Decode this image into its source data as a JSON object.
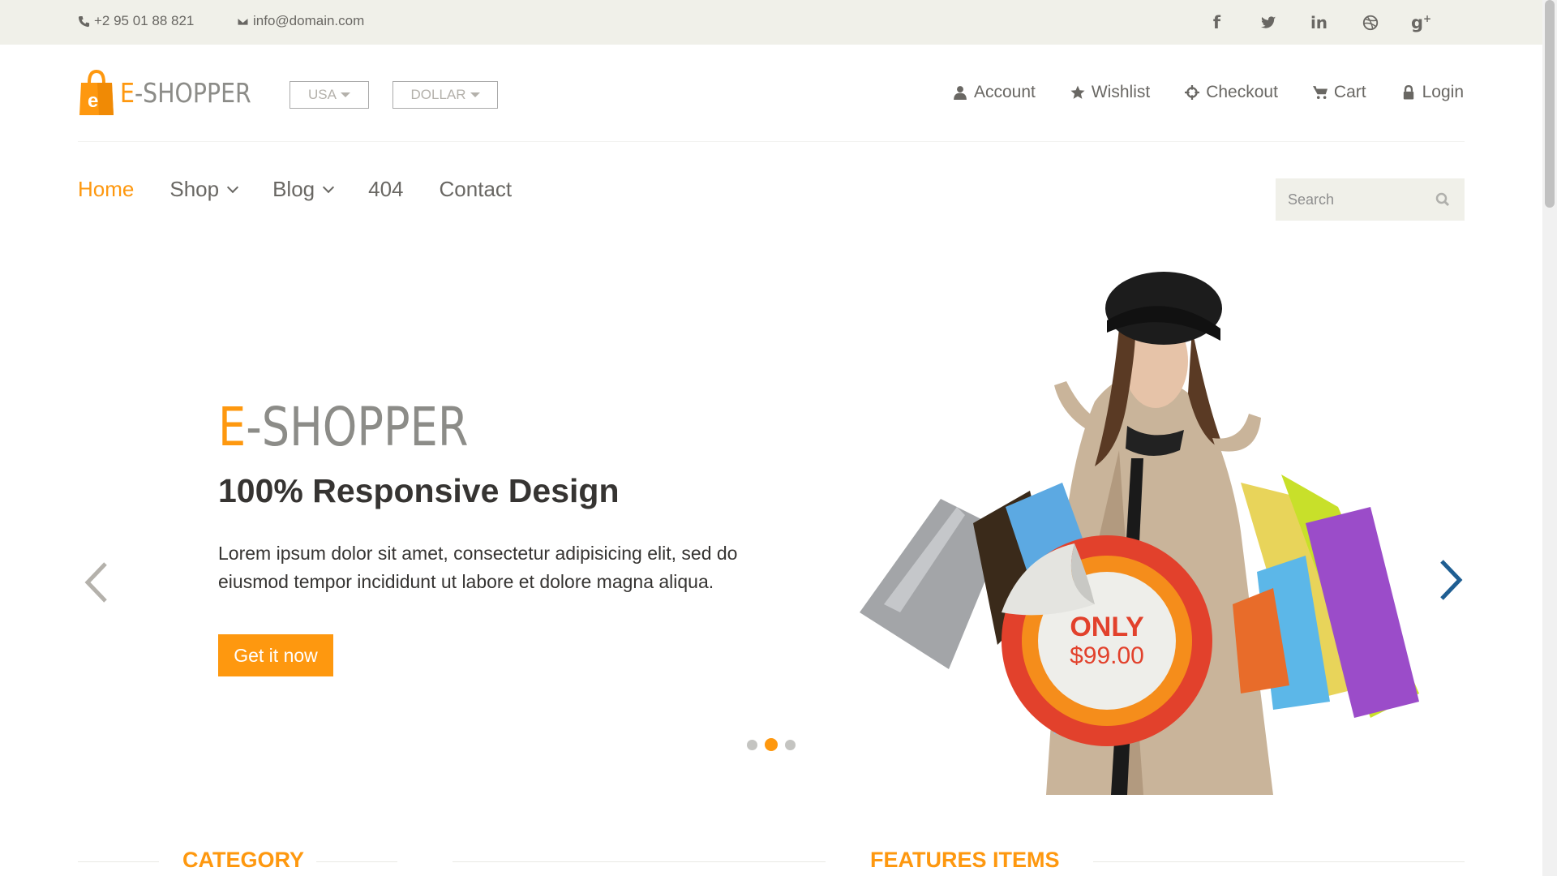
{
  "topbar": {
    "phone": "+2 95 01 88 821",
    "email": "info@domain.com",
    "socials": [
      "facebook-icon",
      "twitter-icon",
      "linkedin-icon",
      "dribbble-icon",
      "google-plus-icon"
    ]
  },
  "header": {
    "logo_e": "E",
    "logo_rest": "-SHOPPER",
    "country": "USA",
    "currency": "DOLLAR",
    "user_menu": [
      {
        "label": "Account",
        "icon": "user-icon"
      },
      {
        "label": "Wishlist",
        "icon": "star-icon"
      },
      {
        "label": "Checkout",
        "icon": "crosshairs-icon"
      },
      {
        "label": "Cart",
        "icon": "cart-icon"
      },
      {
        "label": "Login",
        "icon": "lock-icon"
      }
    ]
  },
  "nav": {
    "items": [
      {
        "label": "Home"
      },
      {
        "label": "Shop"
      },
      {
        "label": "Blog"
      },
      {
        "label": "404"
      },
      {
        "label": "Contact"
      }
    ],
    "search_placeholder": "Search"
  },
  "slider": {
    "title_e": "E",
    "title_rest": "-SHOPPER",
    "subtitle": "100% Responsive Design",
    "description": "Lorem ipsum dolor sit amet, consectetur adipisicing elit, sed do eiusmod tempor incididunt ut labore et dolore magna aliqua.",
    "button": "Get it now",
    "badge_line1": "ONLY",
    "badge_line2": "$99.00",
    "active_slide": 2,
    "slide_count": 3
  },
  "sections": {
    "category": "CATEGORY",
    "features": "FEATURES ITEMS"
  },
  "colors": {
    "accent": "#fe980f",
    "topbar_bg": "#f0f0e9",
    "text": "#696763",
    "badge_red": "#e2412c"
  }
}
